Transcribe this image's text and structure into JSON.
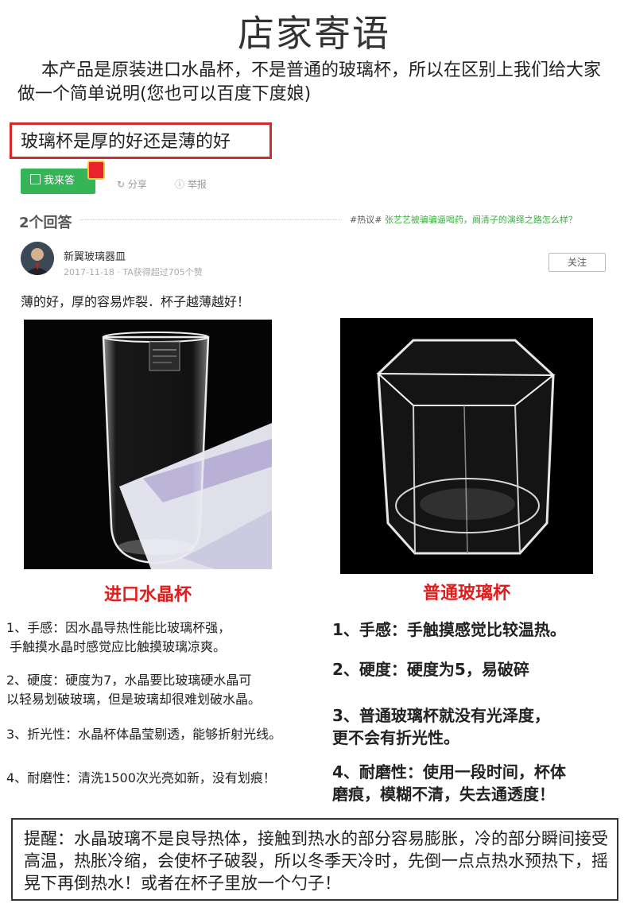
{
  "header": {
    "title": "店家寄语",
    "intro": "本产品是原装进口水晶杯，不是普通的玻璃杯，所以在区别上我们给大家做一个简单说明(您也可以百度下度娘)"
  },
  "qa": {
    "question": "玻璃杯是厚的好还是薄的好",
    "answer_button": "我来答",
    "share": "分享",
    "report": "举报",
    "answer_count": "2个回答",
    "hot_prefix": "#热议#",
    "hot_topic": "张艺艺被骗骗逼喝药，阚清子的演绎之路怎么样？",
    "author": {
      "name": "新翼玻璃器皿",
      "meta": "2017-11-18 · TA获得超过705个赞"
    },
    "follow": "关注",
    "summary": "薄的好，厚的容易炸裂．杯子越薄越好！"
  },
  "images": {
    "left_label_icon": "SCHOTT ZWIESEL",
    "left_caption": "进口水晶杯",
    "right_caption": "普通玻璃杯"
  },
  "crystal_points": [
    {
      "line1": "1、手感：因水晶导热性能比玻璃杯强，",
      "line2": "手触摸水晶时感觉应比触摸玻璃凉爽。"
    },
    {
      "line1": "2、硬度：硬度为7，水晶要比玻璃硬水晶可",
      "line2": "以轻易划破玻璃，但是玻璃却很难划破水晶。"
    },
    {
      "line1": "3、折光性：水晶杯体晶莹剔透，能够折射光线。",
      "line2": ""
    },
    {
      "line1": "4、耐磨性：清洗1500次光亮如新，没有划痕！",
      "line2": ""
    }
  ],
  "glass_points": [
    {
      "line1": "1、手感：手触摸感觉比较温热。",
      "line2": ""
    },
    {
      "line1": "2、硬度：硬度为5，易破碎",
      "line2": ""
    },
    {
      "line1": "3、普通玻璃杯就没有光泽度，",
      "line2": "更不会有折光性。"
    },
    {
      "line1": "4、耐磨性：使用一段时间，杯体",
      "line2": "磨痕，模糊不清，失去通透度！"
    }
  ],
  "tip": "提醒：水晶玻璃不是良导热体，接触到热水的部分容易膨胀，冷的部分瞬间接受高温，热胀冷缩，会使杯子破裂，所以冬季天冷时，先倒一点点热水预热下，摇晃下再倒热水！或者在杯子里放一个勺子！",
  "colors": {
    "accent_red": "#e21b1b",
    "box_red": "#d42a2a",
    "answer_green": "#35b558",
    "hot_green": "#38b03f"
  }
}
